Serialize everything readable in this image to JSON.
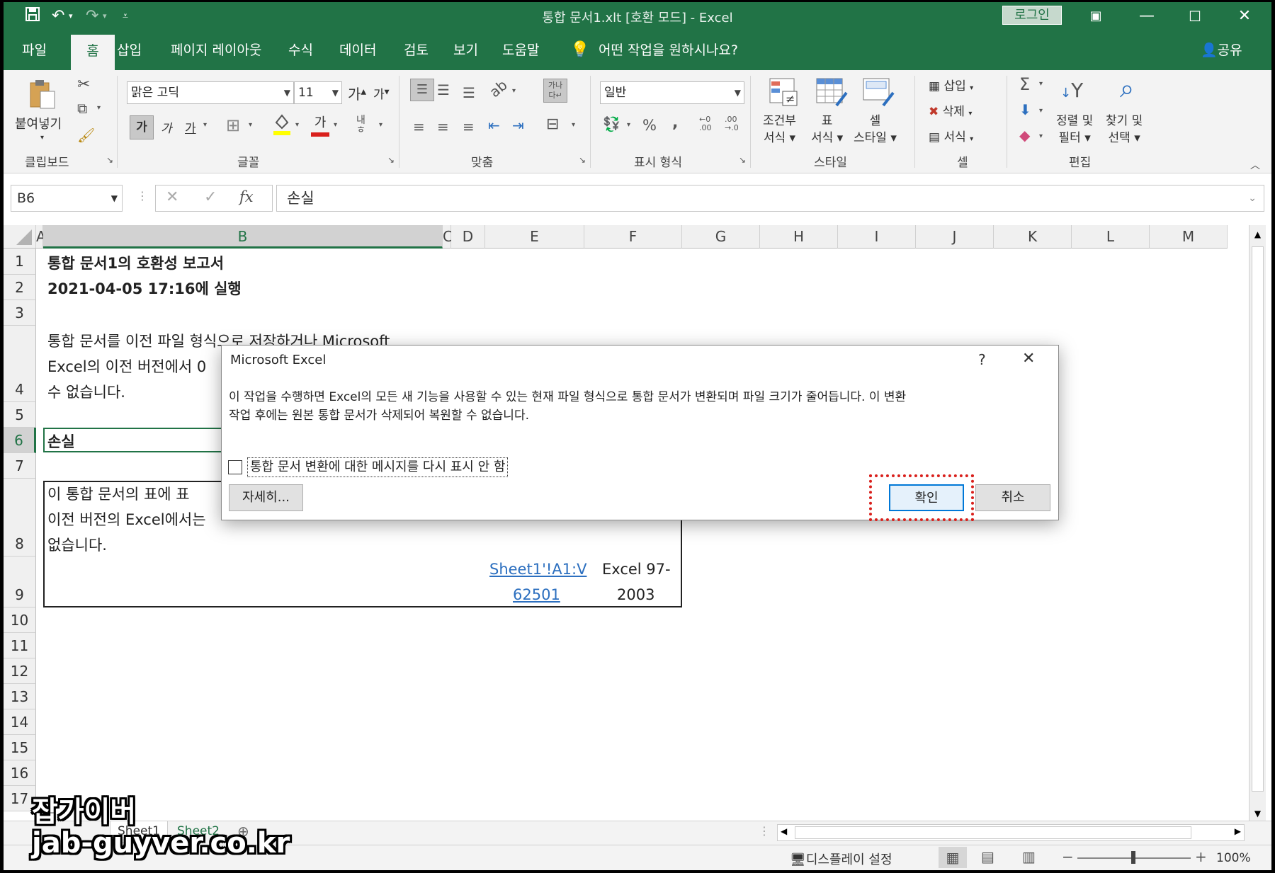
{
  "window": {
    "title": "통합 문서1.xlt  [호환 모드]  -  Excel",
    "login": "로그인"
  },
  "tabs": [
    "파일",
    "홈",
    "삽입",
    "페이지 레이아웃",
    "수식",
    "데이터",
    "검토",
    "보기",
    "도움말"
  ],
  "tell_me": "어떤 작업을 원하시나요?",
  "share": "공유",
  "ribbon": {
    "paste": "붙여넣기",
    "clipboard": "클립보드",
    "font_name": "맑은 고딕",
    "font_size": "11",
    "font_group": "글꼴",
    "align_group": "맞춤",
    "number_format": "일반",
    "number_group": "표시 형식",
    "cond_format": [
      "조건부",
      "서식"
    ],
    "table_format": [
      "표",
      "서식"
    ],
    "cell_style": [
      "셀",
      "스타일"
    ],
    "style_group": "스타일",
    "insert": "삽입",
    "delete": "삭제",
    "format": "서식",
    "cells_group": "셀",
    "sort_filter": [
      "정렬 및",
      "필터"
    ],
    "find_select": [
      "찾기 및",
      "선택"
    ],
    "edit_group": "편집",
    "bold": "가",
    "italic": "가",
    "underline": "가",
    "font_color_letter": "가",
    "grow_font": "가",
    "shrink_font": "가"
  },
  "formula_bar": {
    "name_box": "B6",
    "fx": "fx",
    "value": "손실"
  },
  "columns": [
    "A",
    "B",
    "C",
    "D",
    "E",
    "F",
    "G",
    "H",
    "I",
    "J",
    "K",
    "L",
    "M"
  ],
  "rows": [
    "1",
    "2",
    "3",
    "4",
    "5",
    "6",
    "7",
    "8",
    "9",
    "10",
    "11",
    "12",
    "13",
    "14",
    "15",
    "16",
    "17"
  ],
  "cells": {
    "r1": "통합 문서1의 호환성 보고서",
    "r2": "2021-04-05 17:16에 실행",
    "r4_line1": "통합 문서를 이전 파일 형식으로 저장하거나 Microsoft",
    "r4_line2": "Excel의 이전 버전에서 0",
    "r4_line3": "수 없습니다.",
    "r6": "손실",
    "r8_line1": "이 통합 문서의 표에 표 ",
    "r8_line2": "이전 버전의 Excel에서는",
    "r8_line3": "없습니다.",
    "r9_link1": "Sheet1'!A1:V",
    "r9_link2": "62501",
    "r9_ver1": "Excel 97-",
    "r9_ver2": "2003"
  },
  "dialog": {
    "title": "Microsoft Excel",
    "help": "?",
    "close": "✕",
    "message_line1": "이 작업을 수행하면 Excel의 모든 새 기능을 사용할 수 있는 현재 파일 형식으로 통합 문서가 변환되며 파일 크기가 줄어듭니다. 이 변환",
    "message_line2": "작업 후에는 원본 통합 문서가 삭제되어 복원할 수 없습니다.",
    "checkbox_label": "통합 문서 변환에 대한 메시지를 다시 표시 안 함",
    "checkbox_checked": false,
    "details": "자세히...",
    "ok": "확인",
    "cancel": "취소"
  },
  "sheets": [
    "Sheet1",
    "Sheet2"
  ],
  "status": {
    "display_settings": "디스플레이 설정",
    "zoom": "100%"
  },
  "watermark": [
    "잡가이버",
    "jab-guyver.co.kr"
  ],
  "colors": {
    "excel_green": "#217346",
    "highlight_red": "#d9201c",
    "link_blue": "#2c6fbf"
  }
}
